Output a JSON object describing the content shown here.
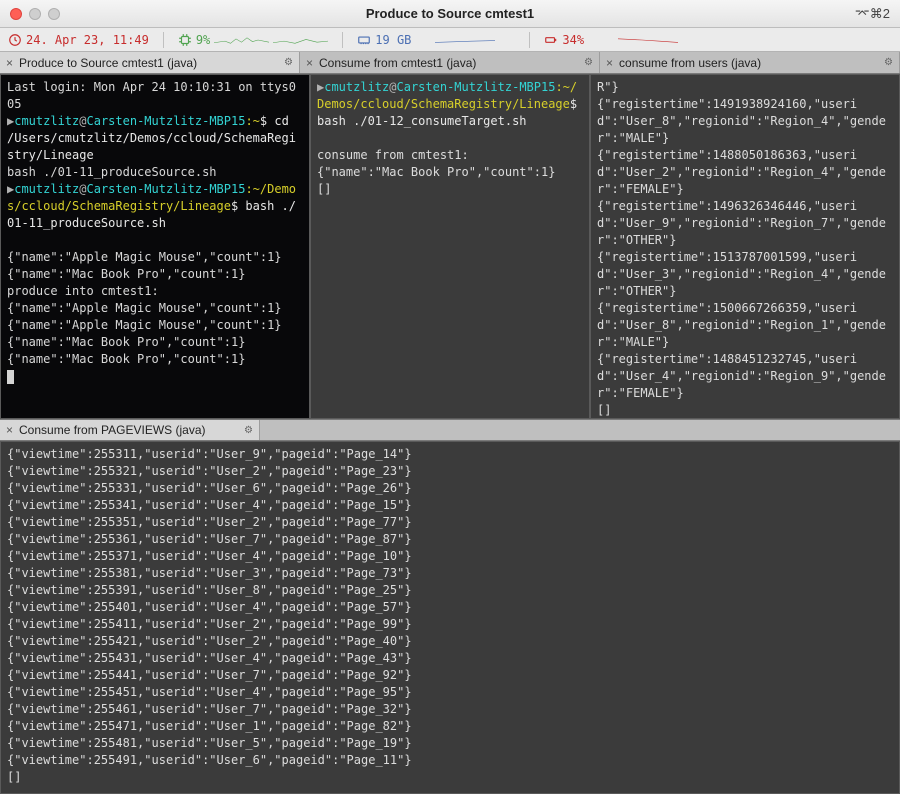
{
  "window": {
    "title": "Produce to Source cmtest1",
    "keyhint": "⌘2",
    "keyx": "⌘"
  },
  "status": {
    "time": "24. Apr 23, 11:49",
    "cpu": "9%",
    "ram": "19 GB",
    "battery": "34%"
  },
  "top_tabs": [
    {
      "name": "Produce to Source cmtest1 (java)",
      "active": true
    },
    {
      "name": "Consume from cmtest1 (java)",
      "active": false
    },
    {
      "name": "consume from users (java)",
      "active": false
    }
  ],
  "bottom_tab": {
    "name": "Consume from PAGEVIEWS (java)"
  },
  "pane1": {
    "lines": [
      {
        "plain": "Last login: Mon Apr 24 10:10:31 on ttys005"
      },
      {
        "prompt": {
          "user": "cmutzlitz",
          "at": "@",
          "host": "Carsten-Mutzlitz-MBP15",
          "path": ":~",
          "dollar": "$"
        },
        "cmd": " cd /Users/cmutzlitz/Demos/ccloud/SchemaRegistry/Lineage"
      },
      {
        "plain": "bash ./01-11_produceSource.sh"
      },
      {
        "prompt": {
          "user": "cmutzlitz",
          "at": "@",
          "host": "Carsten-Mutzlitz-MBP15",
          "path": ":~/Demos/ccloud/SchemaRegistry/Lineage",
          "dollar": "$"
        },
        "cmd": " bash ./01-11_produceSource.sh"
      },
      {
        "plain": ""
      },
      {
        "plain": "{\"name\":\"Apple Magic Mouse\",\"count\":1}"
      },
      {
        "plain": "{\"name\":\"Mac Book Pro\",\"count\":1}"
      },
      {
        "plain": "produce into cmtest1:"
      },
      {
        "plain": "{\"name\":\"Apple Magic Mouse\",\"count\":1}"
      },
      {
        "plain": "{\"name\":\"Apple Magic Mouse\",\"count\":1}"
      },
      {
        "plain": "{\"name\":\"Mac Book Pro\",\"count\":1}"
      },
      {
        "plain": "{\"name\":\"Mac Book Pro\",\"count\":1}"
      }
    ]
  },
  "pane2": {
    "prompt": {
      "user": "cmutzlitz",
      "at": "@",
      "host": "Carsten-Mutzlitz-MBP15",
      "path": ":~/Demos/ccloud/SchemaRegistry/Lineage",
      "dollar": "$"
    },
    "cmd": " bash ./01-12_consumeTarget.sh",
    "rest": [
      "",
      "consume from cmtest1:",
      "{\"name\":\"Mac Book Pro\",\"count\":1}",
      "[]"
    ]
  },
  "pane3": {
    "records": [
      "R\"}",
      "{\"registertime\":1491938924160,\"userid\":\"User_8\",\"regionid\":\"Region_4\",\"gender\":\"MALE\"}",
      "{\"registertime\":1488050186363,\"userid\":\"User_2\",\"regionid\":\"Region_4\",\"gender\":\"FEMALE\"}",
      "{\"registertime\":1496326346446,\"userid\":\"User_9\",\"regionid\":\"Region_7\",\"gender\":\"OTHER\"}",
      "{\"registertime\":1513787001599,\"userid\":\"User_3\",\"regionid\":\"Region_4\",\"gender\":\"OTHER\"}",
      "{\"registertime\":1500667266359,\"userid\":\"User_8\",\"regionid\":\"Region_1\",\"gender\":\"MALE\"}",
      "{\"registertime\":1488451232745,\"userid\":\"User_4\",\"regionid\":\"Region_9\",\"gender\":\"FEMALE\"}",
      "[]"
    ]
  },
  "pageviews": [
    {
      "viewtime": 255311,
      "userid": "User_9",
      "pageid": "Page_14"
    },
    {
      "viewtime": 255321,
      "userid": "User_2",
      "pageid": "Page_23"
    },
    {
      "viewtime": 255331,
      "userid": "User_6",
      "pageid": "Page_26"
    },
    {
      "viewtime": 255341,
      "userid": "User_4",
      "pageid": "Page_15"
    },
    {
      "viewtime": 255351,
      "userid": "User_2",
      "pageid": "Page_77"
    },
    {
      "viewtime": 255361,
      "userid": "User_7",
      "pageid": "Page_87"
    },
    {
      "viewtime": 255371,
      "userid": "User_4",
      "pageid": "Page_10"
    },
    {
      "viewtime": 255381,
      "userid": "User_3",
      "pageid": "Page_73"
    },
    {
      "viewtime": 255391,
      "userid": "User_8",
      "pageid": "Page_25"
    },
    {
      "viewtime": 255401,
      "userid": "User_4",
      "pageid": "Page_57"
    },
    {
      "viewtime": 255411,
      "userid": "User_2",
      "pageid": "Page_99"
    },
    {
      "viewtime": 255421,
      "userid": "User_2",
      "pageid": "Page_40"
    },
    {
      "viewtime": 255431,
      "userid": "User_4",
      "pageid": "Page_43"
    },
    {
      "viewtime": 255441,
      "userid": "User_7",
      "pageid": "Page_92"
    },
    {
      "viewtime": 255451,
      "userid": "User_4",
      "pageid": "Page_95"
    },
    {
      "viewtime": 255461,
      "userid": "User_7",
      "pageid": "Page_32"
    },
    {
      "viewtime": 255471,
      "userid": "User_1",
      "pageid": "Page_82"
    },
    {
      "viewtime": 255481,
      "userid": "User_5",
      "pageid": "Page_19"
    },
    {
      "viewtime": 255491,
      "userid": "User_6",
      "pageid": "Page_11"
    }
  ],
  "pageviews_tail": "[]"
}
